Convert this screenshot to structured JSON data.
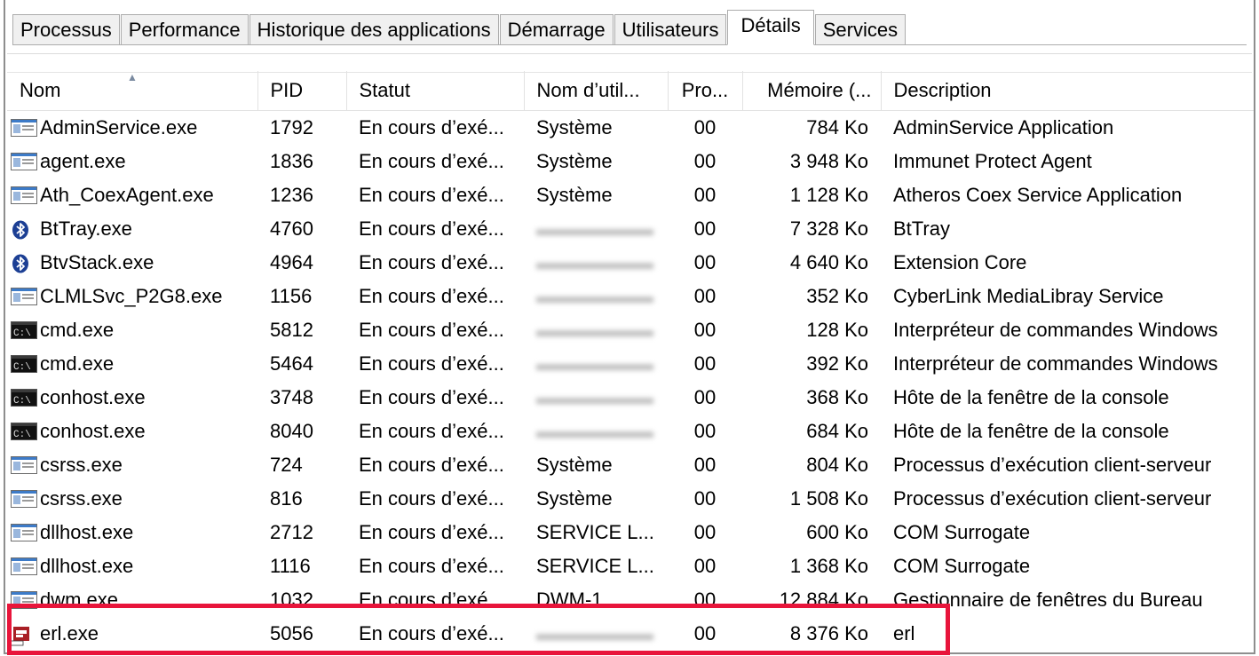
{
  "tabs": [
    {
      "label": "Processus"
    },
    {
      "label": "Performance"
    },
    {
      "label": "Historique des applications"
    },
    {
      "label": "Démarrage"
    },
    {
      "label": "Utilisateurs"
    },
    {
      "label": "Détails",
      "active": true
    },
    {
      "label": "Services"
    }
  ],
  "columns": {
    "name": "Nom",
    "pid": "PID",
    "status": "Statut",
    "user": "Nom d’util...",
    "cpu": "Pro...",
    "memory": "Mémoire (...",
    "description": "Description"
  },
  "rows": [
    {
      "icon": "app-window-icon",
      "name": "AdminService.exe",
      "pid": "1792",
      "status": "En cours d’exé...",
      "user": "Système",
      "user_blurred": false,
      "cpu": "00",
      "memory": "784 Ko",
      "description": "AdminService Application"
    },
    {
      "icon": "app-window-icon",
      "name": "agent.exe",
      "pid": "1836",
      "status": "En cours d’exé...",
      "user": "Système",
      "user_blurred": false,
      "cpu": "00",
      "memory": "3 948 Ko",
      "description": "Immunet Protect Agent"
    },
    {
      "icon": "app-window-icon",
      "name": "Ath_CoexAgent.exe",
      "pid": "1236",
      "status": "En cours d’exé...",
      "user": "Système",
      "user_blurred": false,
      "cpu": "00",
      "memory": "1 128 Ko",
      "description": "Atheros Coex Service Application"
    },
    {
      "icon": "bluetooth-icon",
      "name": "BtTray.exe",
      "pid": "4760",
      "status": "En cours d’exé...",
      "user": "",
      "user_blurred": true,
      "cpu": "00",
      "memory": "7 328 Ko",
      "description": "BtTray"
    },
    {
      "icon": "bluetooth-icon",
      "name": "BtvStack.exe",
      "pid": "4964",
      "status": "En cours d’exé...",
      "user": "",
      "user_blurred": true,
      "cpu": "00",
      "memory": "4 640 Ko",
      "description": "Extension Core"
    },
    {
      "icon": "app-window-icon",
      "name": "CLMLSvc_P2G8.exe",
      "pid": "1156",
      "status": "En cours d’exé...",
      "user": "",
      "user_blurred": true,
      "cpu": "00",
      "memory": "352 Ko",
      "description": "CyberLink MediaLibray Service"
    },
    {
      "icon": "console-icon",
      "name": "cmd.exe",
      "pid": "5812",
      "status": "En cours d’exé...",
      "user": "",
      "user_blurred": true,
      "cpu": "00",
      "memory": "128 Ko",
      "description": "Interpréteur de commandes Windows"
    },
    {
      "icon": "console-icon",
      "name": "cmd.exe",
      "pid": "5464",
      "status": "En cours d’exé...",
      "user": "",
      "user_blurred": true,
      "cpu": "00",
      "memory": "392 Ko",
      "description": "Interpréteur de commandes Windows"
    },
    {
      "icon": "console-icon",
      "name": "conhost.exe",
      "pid": "3748",
      "status": "En cours d’exé...",
      "user": "",
      "user_blurred": true,
      "cpu": "00",
      "memory": "368 Ko",
      "description": "Hôte de la fenêtre de la console"
    },
    {
      "icon": "console-icon",
      "name": "conhost.exe",
      "pid": "8040",
      "status": "En cours d’exé...",
      "user": "",
      "user_blurred": true,
      "cpu": "00",
      "memory": "684 Ko",
      "description": "Hôte de la fenêtre de la console"
    },
    {
      "icon": "app-window-icon",
      "name": "csrss.exe",
      "pid": "724",
      "status": "En cours d’exé...",
      "user": "Système",
      "user_blurred": false,
      "cpu": "00",
      "memory": "804 Ko",
      "description": "Processus d’exécution client-serveur"
    },
    {
      "icon": "app-window-icon",
      "name": "csrss.exe",
      "pid": "816",
      "status": "En cours d’exé...",
      "user": "Système",
      "user_blurred": false,
      "cpu": "00",
      "memory": "1 508 Ko",
      "description": "Processus d’exécution client-serveur"
    },
    {
      "icon": "app-window-icon",
      "name": "dllhost.exe",
      "pid": "2712",
      "status": "En cours d’exé...",
      "user": "SERVICE L...",
      "user_blurred": false,
      "cpu": "00",
      "memory": "600 Ko",
      "description": "COM Surrogate"
    },
    {
      "icon": "app-window-icon",
      "name": "dllhost.exe",
      "pid": "1116",
      "status": "En cours d’exé...",
      "user": "SERVICE L...",
      "user_blurred": false,
      "cpu": "00",
      "memory": "1 368 Ko",
      "description": "COM Surrogate"
    },
    {
      "icon": "app-window-icon",
      "name": "dwm.exe",
      "pid": "1032",
      "status": "En cours d’exé...",
      "user": "DWM-1",
      "user_blurred": false,
      "cpu": "00",
      "memory": "12 884 Ko",
      "description": "Gestionnaire de fenêtres du Bureau"
    },
    {
      "icon": "erlang-icon",
      "name": "erl.exe",
      "pid": "5056",
      "status": "En cours d’exé...",
      "user": "",
      "user_blurred": true,
      "cpu": "00",
      "memory": "8 376 Ko",
      "description": "erl",
      "highlighted": true
    }
  ],
  "colors": {
    "highlight": "#e8153b",
    "bluetooth": "#1c3f94"
  }
}
